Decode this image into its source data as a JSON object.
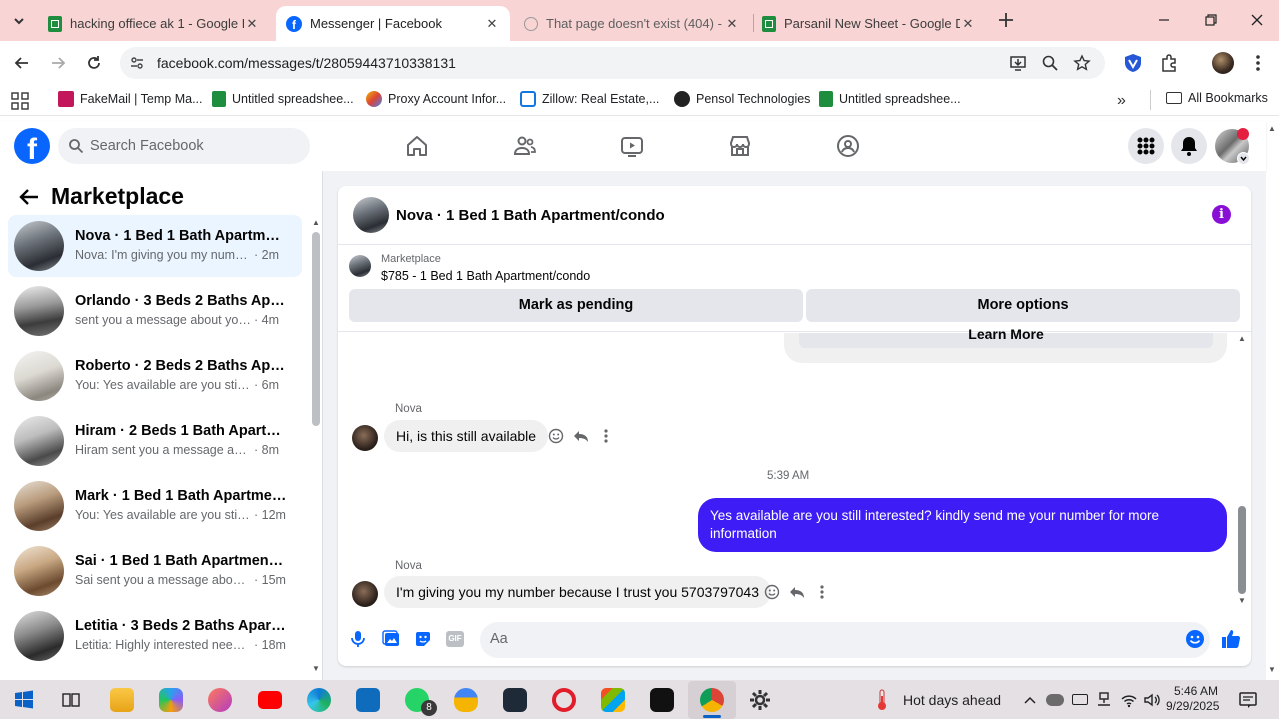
{
  "browser": {
    "tabs": [
      {
        "label": "hacking offiece ak 1 - Google D",
        "icon": "google-sheets-icon"
      },
      {
        "label": "Messenger | Facebook",
        "icon": "facebook-icon"
      },
      {
        "label": "That page doesn't exist (404) - I",
        "icon": "globe-icon"
      },
      {
        "label": "Parsanil New Sheet - Google D",
        "icon": "google-sheets-icon"
      }
    ],
    "url": "facebook.com/messages/t/28059443710338131",
    "bookmarks": [
      "FakeMail | Temp Ma...",
      "Untitled spreadshee...",
      "Proxy Account Infor...",
      "Zillow: Real Estate,...",
      "Pensol Technologies",
      "Untitled spreadshee..."
    ],
    "all_bookmarks": "All Bookmarks"
  },
  "header": {
    "search_placeholder": "Search Facebook"
  },
  "sidebar": {
    "title": "Marketplace",
    "conversations": [
      {
        "name": "Nova · 1 Bed 1 Bath Apartment/...",
        "preview": "Nova: I'm giving you my number ...",
        "time": "· 2m"
      },
      {
        "name": "Orlando · 3 Beds 2 Baths Apart...",
        "preview": "sent you a message about your list...",
        "time": "· 4m"
      },
      {
        "name": "Roberto · 2 Beds 2 Baths Apart...",
        "preview": "You: Yes available are you still inter...",
        "time": "· 6m"
      },
      {
        "name": "Hiram · 2 Beds 1 Bath Apartmen...",
        "preview": "Hiram sent you a message about y...",
        "time": "· 8m"
      },
      {
        "name": "Mark · 1 Bed 1 Bath Apartment/...",
        "preview": "You: Yes available are you still int...",
        "time": "· 12m"
      },
      {
        "name": "Sai · 1 Bed 1 Bath Apartment/co...",
        "preview": "Sai sent you a message about yo...",
        "time": "· 15m"
      },
      {
        "name": "Letitia · 3 Beds 2 Baths Apartme...",
        "preview": "Letitia: Highly interested need to ...",
        "time": "· 18m"
      }
    ]
  },
  "chat": {
    "title": "Nova · 1 Bed 1 Bath Apartment/condo",
    "listing_label": "Marketplace",
    "listing_text": "$785 - 1 Bed 1 Bath Apartment/condo",
    "mark_pending": "Mark as pending",
    "more_options": "More options",
    "learn_more": "Learn More",
    "messages": [
      {
        "sender": "Nova",
        "text": "Hi, is this still available"
      },
      {
        "timestamp": "5:39 AM"
      },
      {
        "sender": "You",
        "text": "Yes available are you still interested? kindly send me your number for more information"
      },
      {
        "sender": "Nova",
        "text": "I'm giving you my number because I trust you 5703797043"
      }
    ],
    "compose_placeholder": "Aa"
  },
  "taskbar": {
    "whatsapp_badge": "8",
    "weather": "Hot days ahead",
    "time": "5:46 AM",
    "date": "9/29/2025"
  },
  "colors": {
    "fb_blue": "#0866ff",
    "outgoing_bubble": "#3d1cf5",
    "tab_bar": "#f8d4d4"
  }
}
